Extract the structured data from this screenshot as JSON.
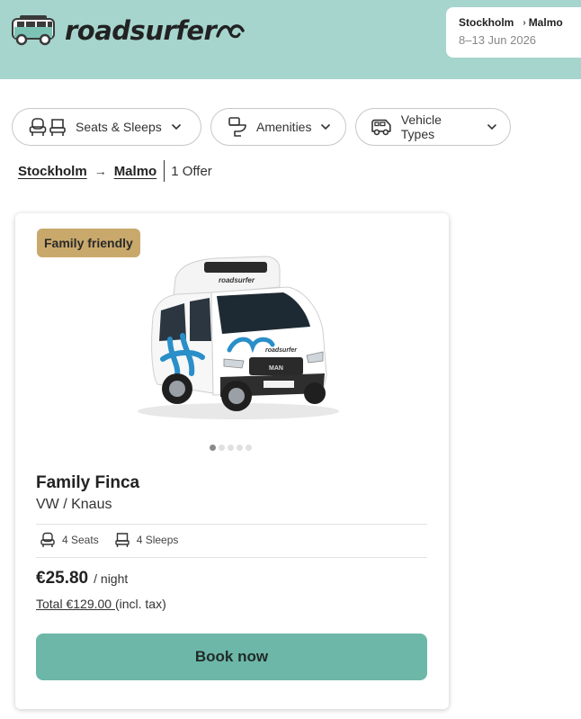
{
  "header": {
    "logo_text": "roadsurfer",
    "trip": {
      "from": "Stockholm",
      "to": "Malmo",
      "dates": "8–13 Jun 2026"
    }
  },
  "filters": [
    {
      "label": "Seats & Sleeps",
      "icon": "seat-icon"
    },
    {
      "label": "Amenities",
      "icon": "toilet-icon"
    },
    {
      "label": "Vehicle Types",
      "icon": "van-icon"
    }
  ],
  "breadcrumb": {
    "from": "Stockholm",
    "arrow": "→",
    "to": "Malmo",
    "offer_count": "1 Offer"
  },
  "offer": {
    "badge": "Family friendly",
    "image_dots": 5,
    "active_dot": 0,
    "title": "Family Finca",
    "subtitle": "VW / Knaus",
    "seats": "4 Seats",
    "sleeps": "4 Sleeps",
    "price": "€25.80",
    "per": "/ night",
    "total_link": "Total €129.00 ",
    "total_suffix": "(incl. tax)",
    "cta": "Book now"
  },
  "colors": {
    "header_bg": "#a6d5cd",
    "badge_bg": "#c9a96b",
    "cta_bg": "#6db7a8",
    "van_accent": "#2a8fc9"
  }
}
